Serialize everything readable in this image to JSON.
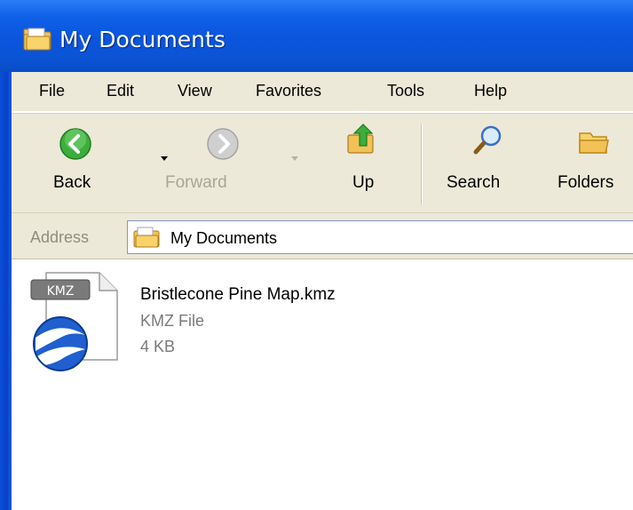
{
  "window": {
    "title": "My Documents",
    "title_icon": "folder-documents-icon",
    "colors": {
      "titlebar": "#0a55dc",
      "chrome": "#ece9d8",
      "disabled_text": "#a7a69a"
    }
  },
  "menubar": {
    "items": [
      "File",
      "Edit",
      "View",
      "Favorites",
      "Tools",
      "Help"
    ]
  },
  "toolbar": {
    "back_label": "Back",
    "forward_label": "Forward",
    "up_label": "Up",
    "search_label": "Search",
    "folders_label": "Folders",
    "icons": {
      "back": "back-arrow-icon",
      "forward": "forward-arrow-icon",
      "up": "up-folder-icon",
      "search": "magnifier-icon",
      "folders": "folder-icon"
    }
  },
  "address": {
    "label": "Address",
    "value": "My Documents",
    "icon": "folder-documents-icon"
  },
  "files": [
    {
      "name": "Bristlecone Pine Map.kmz",
      "type": "KMZ File",
      "size": "4 KB",
      "icon_badge": "KMZ",
      "icon": "google-earth-kmz-icon"
    }
  ]
}
